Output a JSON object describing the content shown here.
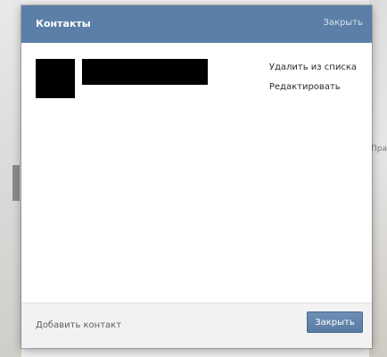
{
  "dialog": {
    "title": "Контакты",
    "header_close_label": "Закрыть"
  },
  "contacts": [
    {
      "name": "",
      "actions": {
        "remove_label": "Удалить из списка",
        "edit_label": "Редактировать"
      }
    }
  ],
  "footer": {
    "add_contact_label": "Добавить контакт",
    "close_button_label": "Закрыть"
  },
  "background": {
    "peek_text": "Прави"
  },
  "colors": {
    "header": "#5b7fa6",
    "button": "#5a7ca3",
    "footer": "#f2f2f2",
    "redaction": "#000000"
  }
}
